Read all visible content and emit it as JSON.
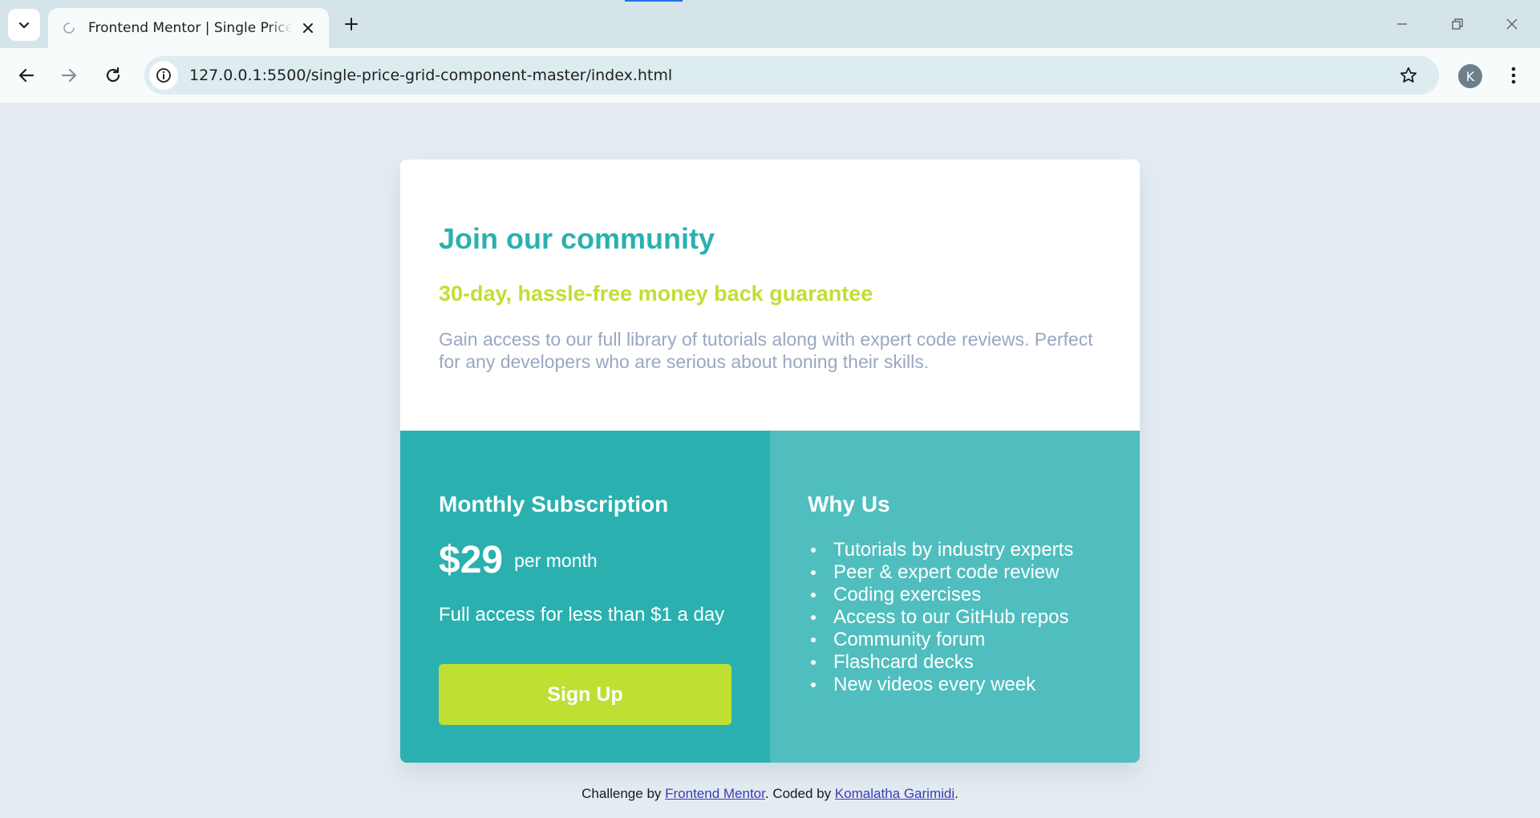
{
  "browser": {
    "tab_title": "Frontend Mentor | Single Price Grid Component",
    "url": "127.0.0.1:5500/single-price-grid-component-master/index.html",
    "profile_initial": "K"
  },
  "card": {
    "heading": "Join our community",
    "guarantee": "30-day, hassle-free money back guarantee",
    "description": "Gain access to our full library of tutorials along with expert code reviews. Perfect for any developers who are serious about honing their skills.",
    "subscription": {
      "title": "Monthly Subscription",
      "price": "$29",
      "period": "per month",
      "note": "Full access for less than $1 a day",
      "button_label": "Sign Up"
    },
    "why": {
      "title": "Why Us",
      "items": [
        "Tutorials by industry experts",
        "Peer & expert code review",
        "Coding exercises",
        "Access to our GitHub repos",
        "Community forum",
        "Flashcard decks",
        "New videos every week"
      ]
    }
  },
  "footer": {
    "prefix": "Challenge by ",
    "challenge_link": "Frontend Mentor",
    "middle": ". Coded by ",
    "author_link": "Komalatha Garimidi",
    "suffix": "."
  },
  "colors": {
    "cyan": "#2bb0b0",
    "light_cyan": "#50bebe",
    "lime": "#bfdf33",
    "grayish_blue": "#9aa7c2",
    "page_bg": "#e4ecf2"
  }
}
